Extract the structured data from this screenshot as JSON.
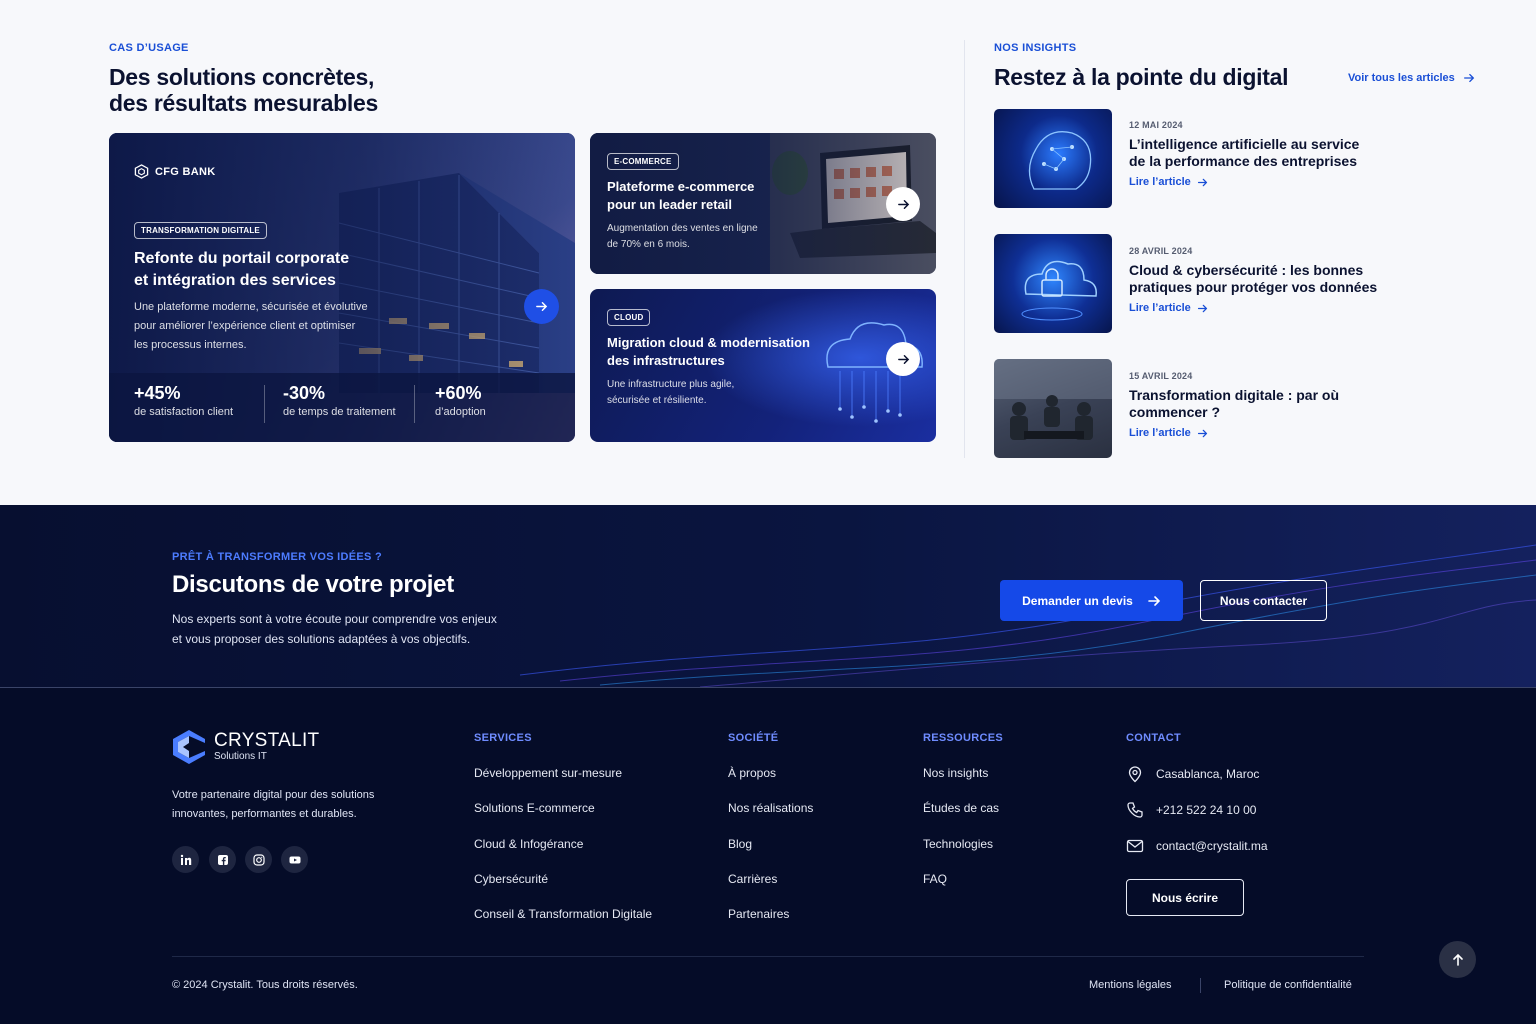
{
  "use_cases": {
    "eyebrow": "CAS D’USAGE",
    "title_line1": "Des solutions concrètes,",
    "title_line2": "des résultats mesurables",
    "main_card": {
      "brand": "CFG BANK",
      "tag": "TRANSFORMATION DIGITALE",
      "title_line1": "Refonte du portail corporate",
      "title_line2": "et intégration des services",
      "desc_line1": "Une plateforme moderne, sécurisée et évolutive",
      "desc_line2": "pour améliorer l’expérience client et optimiser",
      "desc_line3": "les processus internes.",
      "stats": [
        {
          "value": "+45%",
          "label": "de satisfaction client"
        },
        {
          "value": "-30%",
          "label": "de temps de traitement"
        },
        {
          "value": "+60%",
          "label": "d’adoption"
        }
      ]
    },
    "card_ecommerce": {
      "tag": "E-COMMERCE",
      "title_line1": "Plateforme e-commerce",
      "title_line2": "pour un leader retail",
      "desc_line1": "Augmentation des ventes en ligne",
      "desc_line2": "de 70% en 6 mois."
    },
    "card_cloud": {
      "tag": "CLOUD",
      "title_line1": "Migration cloud & modernisation",
      "title_line2": "des infrastructures",
      "desc_line1": "Une infrastructure plus agile,",
      "desc_line2": "sécurisée et résiliente."
    }
  },
  "insights": {
    "eyebrow": "NOS INSIGHTS",
    "title": "Restez à la pointe du digital",
    "see_all": "Voir tous les articles",
    "articles": [
      {
        "date": "12 MAI 2024",
        "title_line1": "L’intelligence artificielle au service",
        "title_line2": "de la performance des entreprises",
        "link": "Lire l’article"
      },
      {
        "date": "28 AVRIL 2024",
        "title_line1": "Cloud & cybersécurité : les bonnes",
        "title_line2": "pratiques pour protéger vos données",
        "link": "Lire l’article"
      },
      {
        "date": "15 AVRIL 2024",
        "title_line1": "Transformation digitale : par où",
        "title_line2": "commencer ?",
        "link": "Lire l’article"
      }
    ]
  },
  "cta": {
    "eyebrow": "PRÊT À TRANSFORMER VOS IDÉES ?",
    "title": "Discutons de votre projet",
    "desc_line1": "Nos experts sont à votre écoute pour comprendre vos enjeux",
    "desc_line2": "et vous proposer des solutions adaptées à vos objectifs.",
    "primary": "Demander un devis",
    "secondary": "Nous contacter"
  },
  "footer": {
    "logo_name": "CRYSTALIT",
    "logo_sub": "Solutions IT",
    "tagline_line1": "Votre partenaire digital pour des solutions",
    "tagline_line2": "innovantes, performantes et durables.",
    "columns": {
      "services": {
        "title": "SERVICES",
        "items": [
          "Développement sur-mesure",
          "Solutions E-commerce",
          "Cloud & Infogérance",
          "Cybersécurité",
          "Conseil & Transformation Digitale"
        ]
      },
      "societe": {
        "title": "SOCIÉTÉ",
        "items": [
          "À propos",
          "Nos réalisations",
          "Blog",
          "Carrières",
          "Partenaires"
        ]
      },
      "ressources": {
        "title": "RESSOURCES",
        "items": [
          "Nos insights",
          "Études de cas",
          "Technologies",
          "FAQ"
        ]
      }
    },
    "contact": {
      "title": "CONTACT",
      "address": "Casablanca, Maroc",
      "phone": "+212 522 24 10 00",
      "email": "contact@crystalit.ma",
      "button": "Nous écrire"
    },
    "copyright": "© 2024 Crystalit. Tous droits réservés.",
    "legal": "Mentions légales",
    "privacy": "Politique de confidentialité"
  },
  "colors": {
    "accent": "#1a4fd6",
    "navy": "#070f2e",
    "button_blue": "#1549e8"
  }
}
